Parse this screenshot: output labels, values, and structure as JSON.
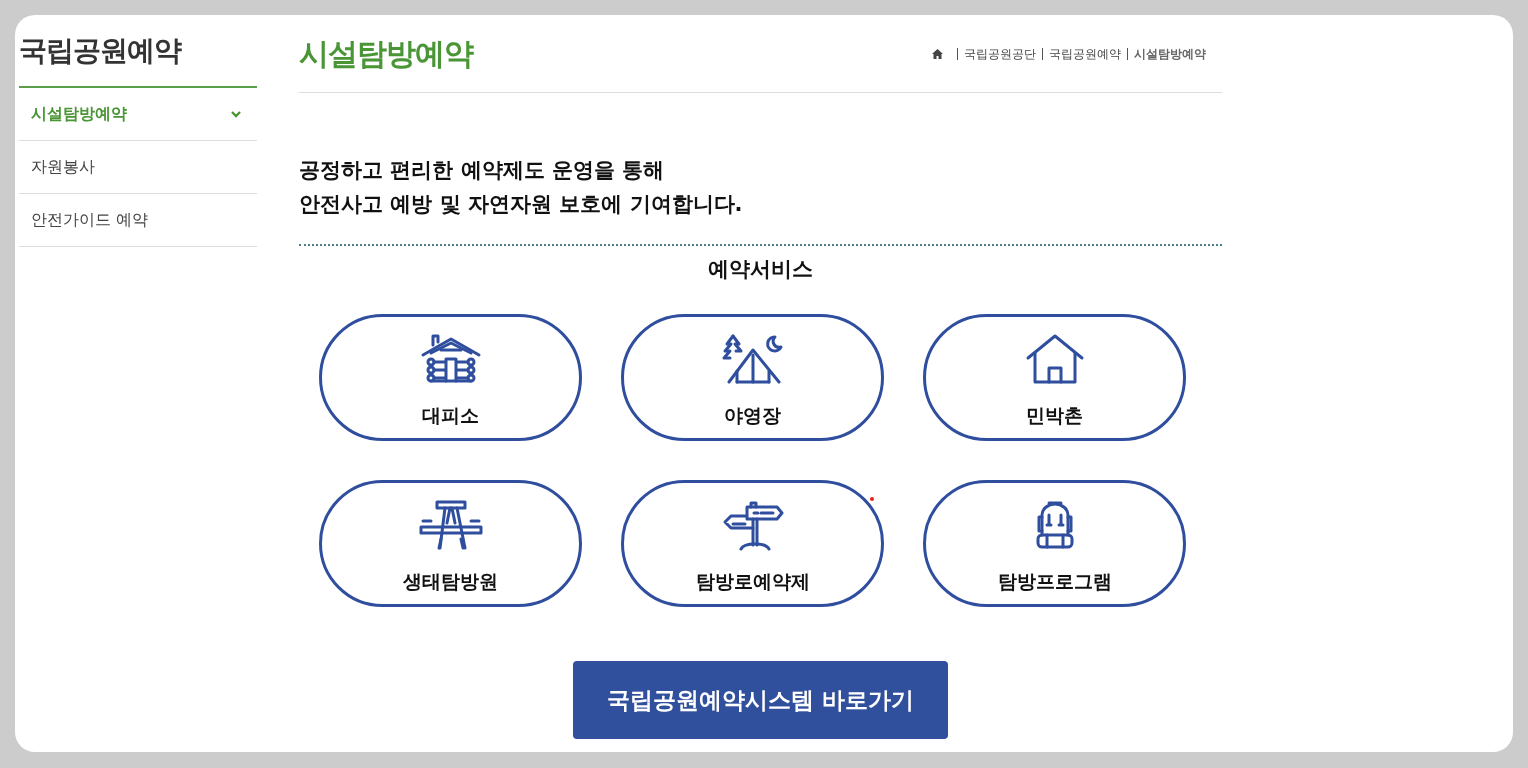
{
  "sidebar": {
    "title": "국립공원예약",
    "items": [
      {
        "label": "시설탐방예약",
        "selected": true
      },
      {
        "label": "자원봉사",
        "selected": false
      },
      {
        "label": "안전가이드 예약",
        "selected": false
      }
    ]
  },
  "header": {
    "title": "시설탐방예약",
    "breadcrumb": [
      {
        "label": "국립공원공단",
        "selected": false
      },
      {
        "label": "국립공원예약",
        "selected": false
      },
      {
        "label": "시설탐방예약",
        "selected": true
      }
    ]
  },
  "intro": [
    "공정하고 편리한 예약제도 운영을 통해",
    "안전사고 예방 및 자연자원 보호에 기여합니다."
  ],
  "services": {
    "title": "예약서비스",
    "items": [
      {
        "label": "대피소",
        "kind": "cabin"
      },
      {
        "label": "야영장",
        "kind": "campsite"
      },
      {
        "label": "민박촌",
        "kind": "house"
      },
      {
        "label": "생태탐방원",
        "kind": "picnic"
      },
      {
        "label": "탐방로예약제",
        "kind": "signpost"
      },
      {
        "label": "탐방프로그램",
        "kind": "backpack"
      }
    ]
  },
  "button": {
    "label": "국립공원예약시스템 바로가기"
  }
}
